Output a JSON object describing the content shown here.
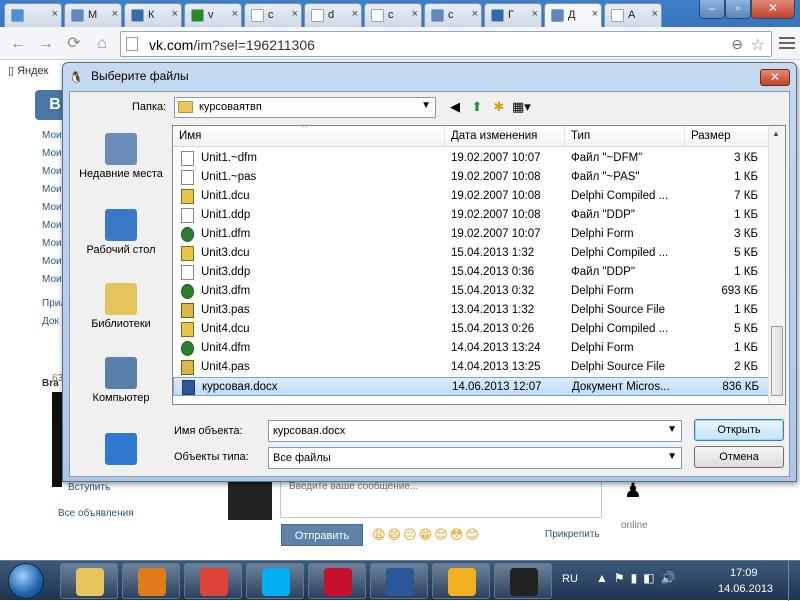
{
  "browser": {
    "tabs": [
      {
        "label": "",
        "color": "#4a90d9",
        "active": false
      },
      {
        "label": "M",
        "color": "#5f86c0",
        "active": false
      },
      {
        "label": "К",
        "color": "#3a6ab0",
        "active": false
      },
      {
        "label": "v",
        "color": "#2a8a2a",
        "active": false
      },
      {
        "label": "c",
        "color": "#ffffff",
        "active": false
      },
      {
        "label": "d",
        "color": "#ffffff",
        "active": false
      },
      {
        "label": "c",
        "color": "#ffffff",
        "active": false
      },
      {
        "label": "c",
        "color": "#5f86c0",
        "active": false
      },
      {
        "label": "Г",
        "color": "#2e6bb0",
        "active": false
      },
      {
        "label": "Д",
        "color": "#5f86c0",
        "active": true
      },
      {
        "label": "А",
        "color": "#ffffff",
        "active": false
      }
    ],
    "url_host": "vk.com",
    "url_path": "/im?sel=196211306",
    "bookmark": "Яндек"
  },
  "vk": {
    "logo": "В",
    "left_items": [
      "Мои",
      "Мои",
      "Мои",
      "Мои",
      "Мои",
      "Мои",
      "Мои",
      "Мои",
      "Мои"
    ],
    "left_items2": [
      "Прил",
      "Док"
    ],
    "left_bra": "Bra",
    "left_num": "63",
    "join": "Вступить",
    "ads": "Все объявления",
    "msg_placeholder": "Введите ваше сообщение...",
    "send": "Отправить",
    "emojis": "😩😄😐😁😌😳😊",
    "attach": "Прикрепить",
    "online": "online"
  },
  "dialog": {
    "title": "Выберите файлы",
    "folder_label": "Папка:",
    "folder_value": "курсоваятвп",
    "places": [
      {
        "label": "Недавние места",
        "icon": "recent-places-icon",
        "color": "#6a8db8"
      },
      {
        "label": "Рабочий стол",
        "icon": "desktop-icon",
        "color": "#3a78c8"
      },
      {
        "label": "Библиотеки",
        "icon": "libraries-icon",
        "color": "#e5c35d"
      },
      {
        "label": "Компьютер",
        "icon": "computer-icon",
        "color": "#5a7fa8"
      },
      {
        "label": "",
        "icon": "network-icon",
        "color": "#2f7ad0"
      }
    ],
    "columns": {
      "name": "Имя",
      "date": "Дата изменения",
      "type": "Тип",
      "size": "Размер"
    },
    "files": [
      {
        "name": "Unit1.~dfm",
        "date": "19.02.2007 10:07",
        "type": "Файл \"~DFM\"",
        "size": "3 КБ",
        "icon": "doc"
      },
      {
        "name": "Unit1.~pas",
        "date": "19.02.2007 10:08",
        "type": "Файл \"~PAS\"",
        "size": "1 КБ",
        "icon": "doc"
      },
      {
        "name": "Unit1.dcu",
        "date": "19.02.2007 10:08",
        "type": "Delphi Compiled ...",
        "size": "7 КБ",
        "icon": "dcu"
      },
      {
        "name": "Unit1.ddp",
        "date": "19.02.2007 10:08",
        "type": "Файл \"DDP\"",
        "size": "1 КБ",
        "icon": "doc"
      },
      {
        "name": "Unit1.dfm",
        "date": "19.02.2007 10:07",
        "type": "Delphi Form",
        "size": "3 КБ",
        "icon": "dfm"
      },
      {
        "name": "Unit3.dcu",
        "date": "15.04.2013 1:32",
        "type": "Delphi Compiled ...",
        "size": "5 КБ",
        "icon": "dcu"
      },
      {
        "name": "Unit3.ddp",
        "date": "15.04.2013 0:36",
        "type": "Файл \"DDP\"",
        "size": "1 КБ",
        "icon": "doc"
      },
      {
        "name": "Unit3.dfm",
        "date": "15.04.2013 0:32",
        "type": "Delphi Form",
        "size": "693 КБ",
        "icon": "dfm"
      },
      {
        "name": "Unit3.pas",
        "date": "13.04.2013 1:32",
        "type": "Delphi Source File",
        "size": "1 КБ",
        "icon": "pas"
      },
      {
        "name": "Unit4.dcu",
        "date": "15.04.2013 0:26",
        "type": "Delphi Compiled ...",
        "size": "5 КБ",
        "icon": "dcu"
      },
      {
        "name": "Unit4.dfm",
        "date": "14.04.2013 13:24",
        "type": "Delphi Form",
        "size": "1 КБ",
        "icon": "dfm"
      },
      {
        "name": "Unit4.pas",
        "date": "14.04.2013 13:25",
        "type": "Delphi Source File",
        "size": "2 КБ",
        "icon": "pas"
      },
      {
        "name": "курсовая.docx",
        "date": "14.06.2013 12:07",
        "type": "Документ Micros...",
        "size": "836 КБ",
        "icon": "word",
        "selected": true
      }
    ],
    "name_label": "Имя объекта:",
    "name_value": "курсовая.docx",
    "type_label": "Объекты типа:",
    "type_value": "Все файлы",
    "open": "Открыть",
    "cancel": "Отмена"
  },
  "taskbar": {
    "apps": [
      {
        "name": "explorer",
        "color": "#e5c35d"
      },
      {
        "name": "media-player",
        "color": "#e07b1a"
      },
      {
        "name": "chrome",
        "color": "#db4437"
      },
      {
        "name": "skype",
        "color": "#00aff0"
      },
      {
        "name": "acrobat",
        "color": "#c8102e"
      },
      {
        "name": "word",
        "color": "#2b579a"
      },
      {
        "name": "delphi7",
        "color": "#f2b01e"
      },
      {
        "name": "qip",
        "color": "#222222"
      }
    ],
    "lang": "RU",
    "time": "17:09",
    "date": "14.06.2013"
  }
}
